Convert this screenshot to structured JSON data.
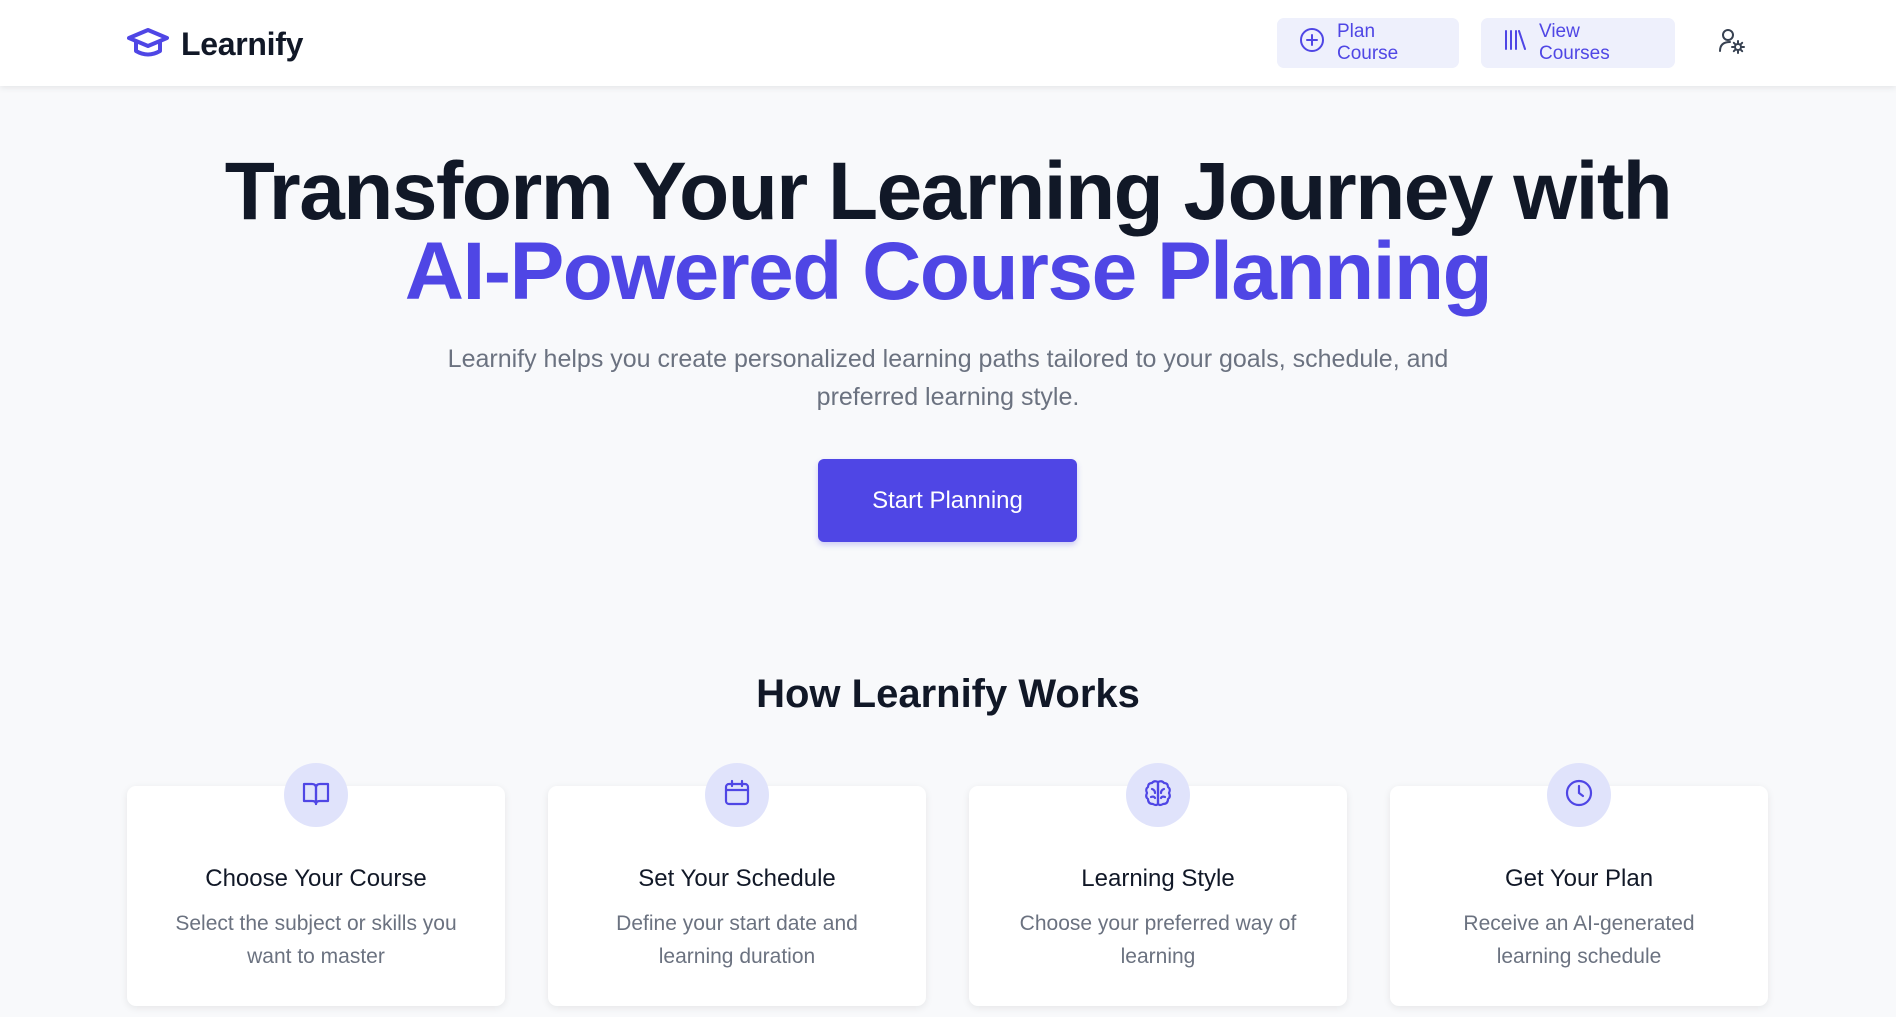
{
  "brand": {
    "name": "Learnify",
    "icon": "graduation-cap-icon"
  },
  "nav": {
    "plan_course": {
      "label": "Plan Course",
      "icon": "plus-circle-icon"
    },
    "view_courses": {
      "label": "View Courses",
      "icon": "library-icon"
    },
    "user_settings": {
      "icon": "user-settings-icon"
    }
  },
  "hero": {
    "title_line1": "Transform Your Learning Journey with",
    "title_line2": "AI-Powered Course Planning",
    "subtitle": "Learnify helps you create personalized learning paths tailored to your goals, schedule, and preferred learning style.",
    "cta": "Start Planning"
  },
  "how_it_works": {
    "title": "How Learnify Works",
    "steps": [
      {
        "icon": "book-open-icon",
        "title": "Choose Your Course",
        "description": "Select the subject or skills you want to master"
      },
      {
        "icon": "calendar-icon",
        "title": "Set Your Schedule",
        "description": "Define your start date and learning duration"
      },
      {
        "icon": "brain-icon",
        "title": "Learning Style",
        "description": "Choose your preferred way of learning"
      },
      {
        "icon": "clock-icon",
        "title": "Get Your Plan",
        "description": "Receive an AI-generated learning schedule"
      }
    ]
  },
  "colors": {
    "accent": "#4f46e5",
    "accent_soft": "#eef0fc",
    "heading": "#111827",
    "muted_text": "#6b7280",
    "page_background": "#f8f9fb"
  }
}
